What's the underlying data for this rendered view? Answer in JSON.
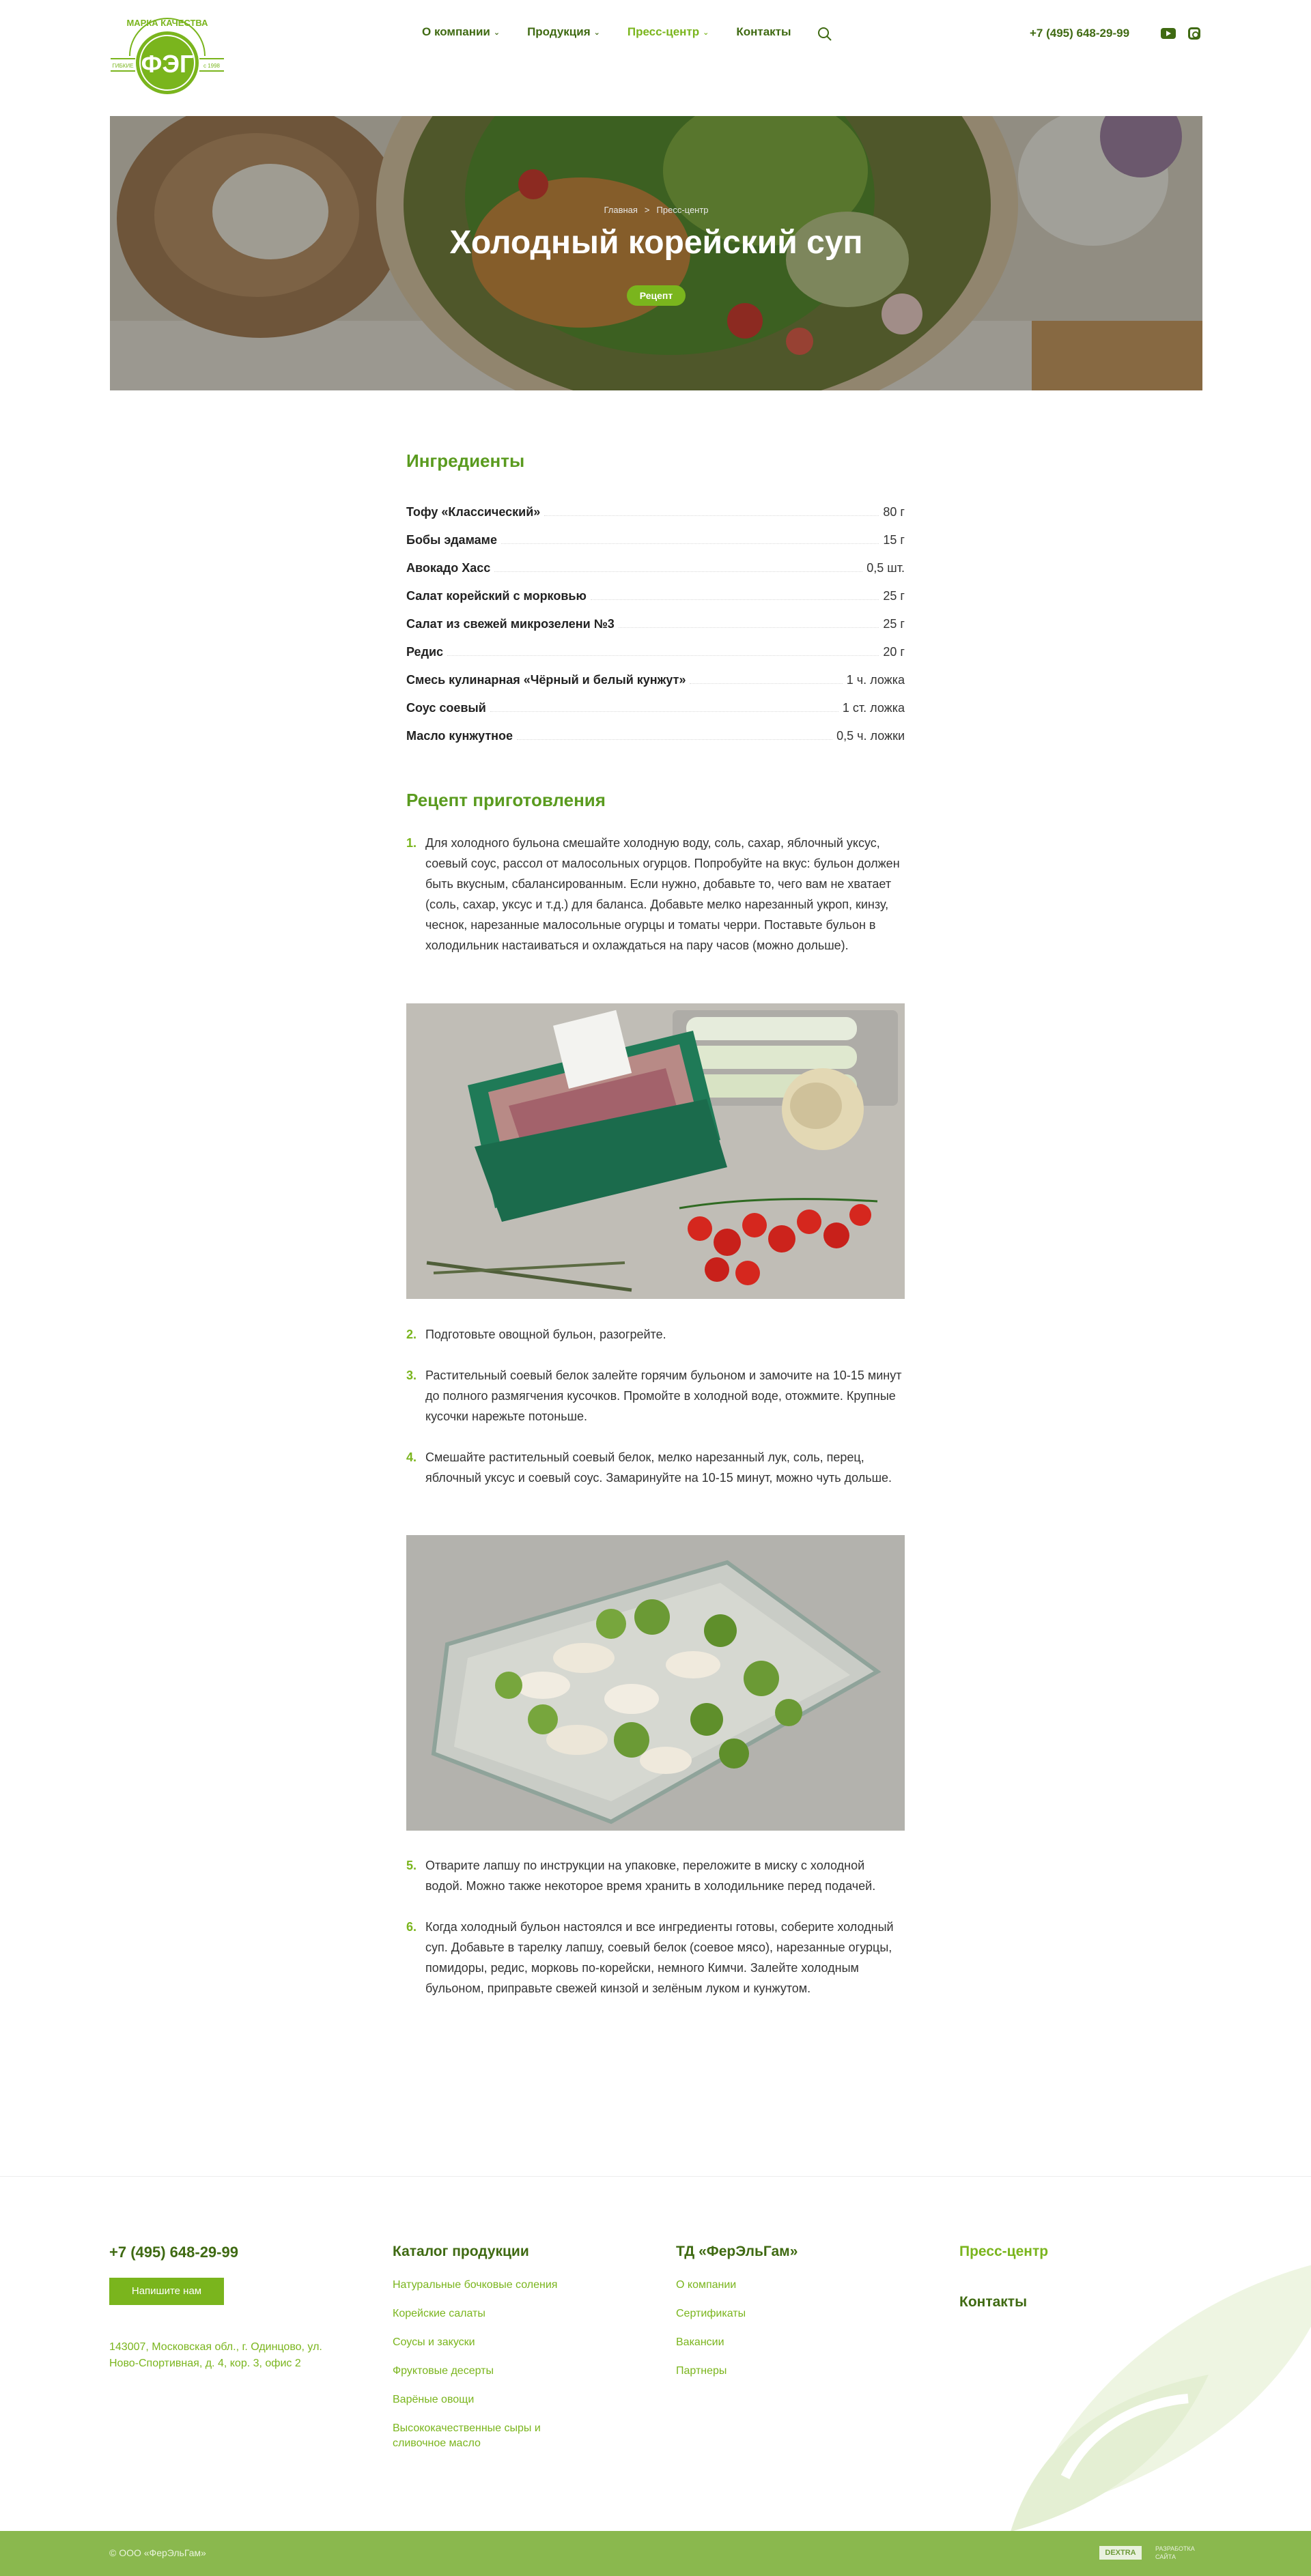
{
  "header": {
    "logo": {
      "arc_text": "МАРКА КАЧЕСТВА",
      "main_text": "ФЭГ",
      "side_left": "ГИБКИЕ",
      "side_right": "с 1998"
    },
    "nav": [
      {
        "label": "О компании",
        "dropdown": true,
        "active": false
      },
      {
        "label": "Продукция",
        "dropdown": true,
        "active": false
      },
      {
        "label": "Пресс-центр",
        "dropdown": true,
        "active": true
      },
      {
        "label": "Контакты",
        "dropdown": false,
        "active": false
      }
    ],
    "chevron": "⌄",
    "phone": "+7 (495) 648-29-99"
  },
  "hero": {
    "breadcrumb": [
      "Главная",
      "Пресс-центр"
    ],
    "breadcrumb_sep": ">",
    "title": "Холодный корейский суп",
    "badge": "Рецепт"
  },
  "ingredients": {
    "title": "Ингредиенты",
    "items": [
      {
        "name": "Тофу «Классический»",
        "qty": "80 г"
      },
      {
        "name": "Бобы эдамаме",
        "qty": "15 г"
      },
      {
        "name": "Авокадо Хасс",
        "qty": "0,5 шт."
      },
      {
        "name": "Салат корейский с морковью",
        "qty": "25 г"
      },
      {
        "name": "Салат из свежей микрозелени №3",
        "qty": "25 г"
      },
      {
        "name": "Редис",
        "qty": "20 г"
      },
      {
        "name": "Смесь кулинарная «Чёрный и белый кунжут»",
        "qty": "1 ч. ложка"
      },
      {
        "name": "Соус соевый",
        "qty": "1 ст. ложка"
      },
      {
        "name": "Масло кунжутное",
        "qty": "0,5 ч. ложки"
      }
    ]
  },
  "recipe": {
    "title": "Рецепт приготовления",
    "steps": [
      {
        "num": "1.",
        "text": "Для холодного бульона смешайте холодную воду, соль, сахар, яблочный уксус, соевый соус, рассол от малосольных огурцов. Попробуйте на вкус: бульон должен быть вкусным, сбалансированным. Если нужно, добавьте то, чего вам не хватает (соль, сахар, уксус и т.д.) для баланса. Добавьте мелко нарезанный укроп, кинзу, чеснок, нарезанные малосольные огурцы и томаты черри. Поставьте бульон в холодильник настаиваться и охлаждаться на пару часов (можно дольше)."
      },
      {
        "num": "2.",
        "text": "Подготовьте овощной бульон, разогрейте."
      },
      {
        "num": "3.",
        "text": "Растительный соевый белок залейте горячим бульоном и замочите на 10-15 минут до полного размягчения кусочков. Промойте в холодной воде, отожмите. Крупные кусочки нарежьте потоньше."
      },
      {
        "num": "4.",
        "text": "Смешайте растительный соевый белок, мелко нарезанный лук, соль, перец, яблочный уксус и соевый соус. Замаринуйте на 10-15 минут, можно чуть дольше."
      },
      {
        "num": "5.",
        "text": "Отварите лапшу по инструкции на упаковке, переложите в миску с холодной водой. Можно также некоторое время хранить в холодильнике перед подачей."
      },
      {
        "num": "6.",
        "text": "Когда холодный бульон настоялся и все ингредиенты готовы, соберите холодный суп. Добавьте в тарелку лапшу, соевый белок (соевое мясо), нарезанные огурцы, помидоры, редис, морковь по-корейски, немного Кимчи. Залейте холодным бульоном, приправьте свежей кинзой и зелёным луком и кунжутом."
      }
    ]
  },
  "footer": {
    "phone": "+7 (495) 648-29-99",
    "write_button": "Напишите нам",
    "address": "143007, Московская обл., г. Одинцово, ул. Ново-Спортивная, д. 4, кор. 3, офис 2",
    "catalog": {
      "title": "Каталог продукции",
      "links": [
        "Натуральные бочковые соления",
        "Корейские салаты",
        "Соусы и закуски",
        "Фруктовые десерты",
        "Варёные овощи",
        "Высококачественные сыры и сливочное масло"
      ]
    },
    "company": {
      "title": "ТД «ФерЭльГам»",
      "links": [
        "О компании",
        "Сертификаты",
        "Вакансии",
        "Партнеры"
      ]
    },
    "press": "Пресс-центр",
    "contacts": "Контакты",
    "copyright": "© ООО «ФерЭльГам»",
    "dev_badge": "DEXTRA",
    "dev_note": [
      "РАЗРАБОТКА",
      "САЙТА"
    ]
  },
  "colors": {
    "brand_green": "#7ab51d",
    "dark_green": "#3f6a12",
    "bottom_bar": "#8ab84e"
  }
}
